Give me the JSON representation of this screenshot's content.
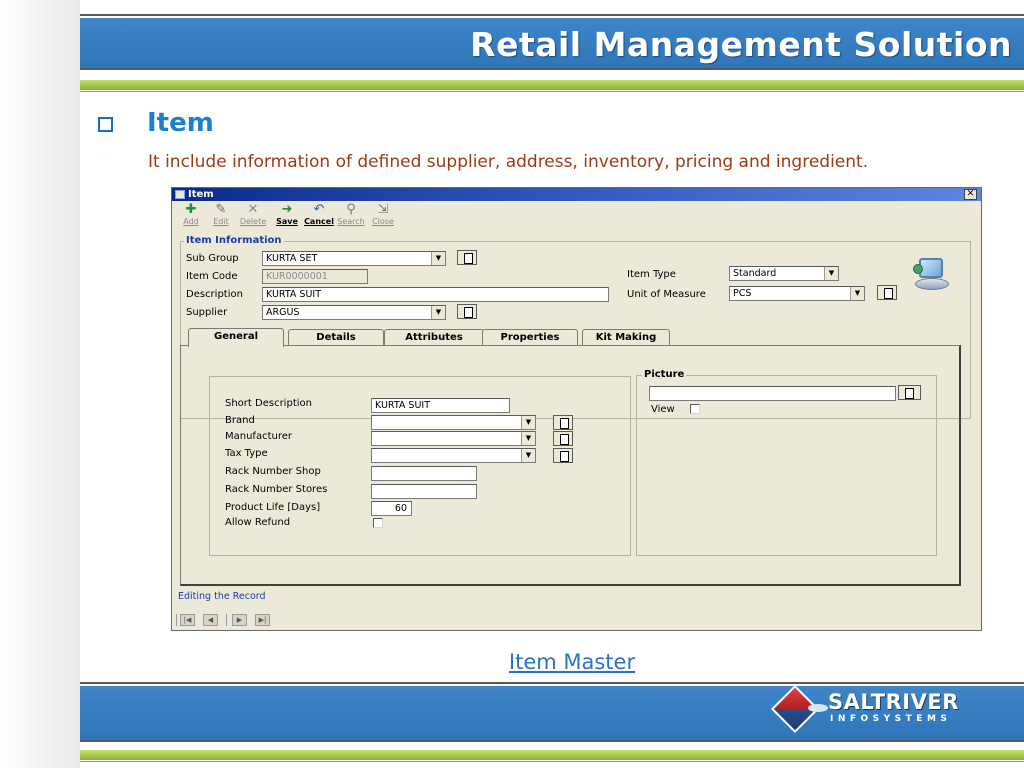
{
  "slide": {
    "banner_title": "Retail Management Solution",
    "heading": "Item",
    "description": "It include information of defined supplier, address, inventory, pricing and ingredient.",
    "caption": "Item Master",
    "logo": {
      "name": "SALTRIVER",
      "sub": "INFOSYSTEMS"
    },
    "colors": {
      "banner_blue": "#2f75b9",
      "banner_green": "#84b43a",
      "heading": "#1b7fcf",
      "description": "#9b3b14",
      "caption": "#2a73c8"
    }
  },
  "window": {
    "title": "Item",
    "close_label": "✕",
    "toolbar": [
      {
        "label": "Add",
        "icon": "add-icon",
        "glyph": "✚",
        "state": "disabled"
      },
      {
        "label": "Edit",
        "icon": "edit-icon",
        "glyph": "✎",
        "state": "disabled"
      },
      {
        "label": "Delete",
        "icon": "delete-icon",
        "glyph": "✕",
        "state": "disabled"
      },
      {
        "label": "Save",
        "icon": "save-icon",
        "glyph": "➜",
        "state": "active"
      },
      {
        "label": "Cancel",
        "icon": "cancel-icon",
        "glyph": "↶",
        "state": "active"
      },
      {
        "label": "Search",
        "icon": "search-icon",
        "glyph": "⚲",
        "state": "disabled"
      },
      {
        "label": "Close",
        "icon": "close-door-icon",
        "glyph": "⇲",
        "state": "disabled"
      }
    ],
    "item_info": {
      "legend": "Item Information",
      "sub_group_label": "Sub Group",
      "sub_group_value": "KURTA SET",
      "item_code_label": "Item Code",
      "item_code_value": "KUR0000001",
      "description_label": "Description",
      "description_value": "KURTA SUIT",
      "supplier_label": "Supplier",
      "supplier_value": "ARGUS",
      "item_type_label": "Item Type",
      "item_type_value": "Standard",
      "uom_label": "Unit of Measure",
      "uom_value": "PCS"
    },
    "tabs": [
      {
        "label": "General",
        "active": true
      },
      {
        "label": "Details",
        "active": false
      },
      {
        "label": "Attributes",
        "active": false
      },
      {
        "label": "Properties",
        "active": false
      },
      {
        "label": "Kit Making",
        "active": false
      }
    ],
    "general": {
      "short_description_label": "Short Description",
      "short_description_value": "KURTA SUIT",
      "brand_label": "Brand",
      "brand_value": "",
      "manufacturer_label": "Manufacturer",
      "manufacturer_value": "",
      "tax_type_label": "Tax Type",
      "tax_type_value": "",
      "rack_shop_label": "Rack Number Shop",
      "rack_shop_value": "",
      "rack_stores_label": "Rack Number Stores",
      "rack_stores_value": "",
      "product_life_label": "Product Life [Days]",
      "product_life_value": "60",
      "allow_refund_label": "Allow Refund",
      "allow_refund_checked": false
    },
    "picture": {
      "legend": "Picture",
      "path_value": "",
      "browse_label": "...",
      "view_label": "View",
      "view_checked": false
    },
    "status_text": "Editing the Record",
    "nav_buttons": [
      "first-icon",
      "prev-icon",
      "next-icon",
      "last-icon"
    ]
  }
}
